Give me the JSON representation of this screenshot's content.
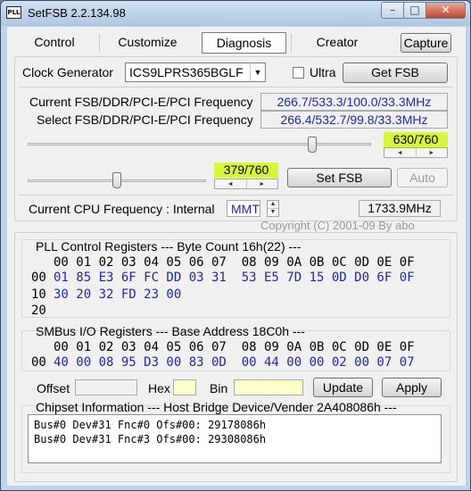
{
  "window": {
    "title": "SetFSB 2.2.134.98",
    "icon_text": "PLL",
    "controls": {
      "minimize": "–",
      "maximize": "□",
      "close": "✕"
    }
  },
  "tabs": [
    {
      "label": "Control",
      "active": false
    },
    {
      "label": "Customize",
      "active": false
    },
    {
      "label": "Diagnosis",
      "active": true
    },
    {
      "label": "Creator",
      "active": false
    }
  ],
  "capture_label": "Capture",
  "clock": {
    "label": "Clock Generator",
    "value": "ICS9LPRS365BGLF",
    "ultra_label": "Ultra",
    "ultra_checked": false,
    "get_fsb_label": "Get FSB"
  },
  "freq": {
    "current_label": "Current FSB/DDR/PCI-E/PCI Frequency",
    "current_value": "266.7/533.3/100.0/33.3MHz",
    "select_label": "Select FSB/DDR/PCI-E/PCI Frequency",
    "select_value": "266.4/532.7/99.8/33.3MHz"
  },
  "slider1": {
    "readout": "630/760",
    "position": 0.829
  },
  "slider2": {
    "readout": "379/760",
    "position": 0.499
  },
  "set_fsb_label": "Set FSB",
  "auto_label": "Auto",
  "cpu": {
    "label": "Current CPU Frequency : Internal",
    "mode": "MMT",
    "value": "1733.9MHz"
  },
  "copyright": "Copyright (C) 2001-09 By abo",
  "pll": {
    "title": "PLL Control Registers  --- Byte Count 16h(22) ---",
    "header": "00 01 02 03 04 05 06 07  08 09 0A 0B 0C 0D 0E 0F",
    "rows": [
      {
        "addr": "00",
        "values": "01 85 E3 6F FC DD 03 31  53 E5 7D 15 0D D0 6F 0F"
      },
      {
        "addr": "10",
        "values": "30 20 32 FD 23 00"
      },
      {
        "addr": "20",
        "values": ""
      }
    ]
  },
  "smbus": {
    "title": "SMBus I/O Registers  --- Base Address 18C0h ---",
    "header": "00 01 02 03 04 05 06 07  08 09 0A 0B 0C 0D 0E 0F",
    "rows": [
      {
        "addr": "00",
        "values": "40 00 08 95 D3 00 83 0D  00 44 00 00 02 00 07 07"
      }
    ]
  },
  "edit": {
    "offset_label": "Offset",
    "offset_value": "",
    "hex_label": "Hex",
    "hex_value": "",
    "bin_label": "Bin",
    "bin_value": "",
    "update_label": "Update",
    "apply_label": "Apply"
  },
  "chipset": {
    "title": "Chipset Information  --- Host Bridge Device/Vender 2A408086h ---",
    "lines": [
      "Bus#0 Dev#31 Fnc#0 Ofs#00: 29178086h",
      "Bus#0 Dev#31 Fnc#3 Ofs#00: 29308086h"
    ]
  },
  "colors": {
    "readout_text": "#1f2a9c",
    "slider_readout_bg": "#d8f540",
    "hex_field_bg": "#ffffcc",
    "frame": "#bcd3ea"
  }
}
